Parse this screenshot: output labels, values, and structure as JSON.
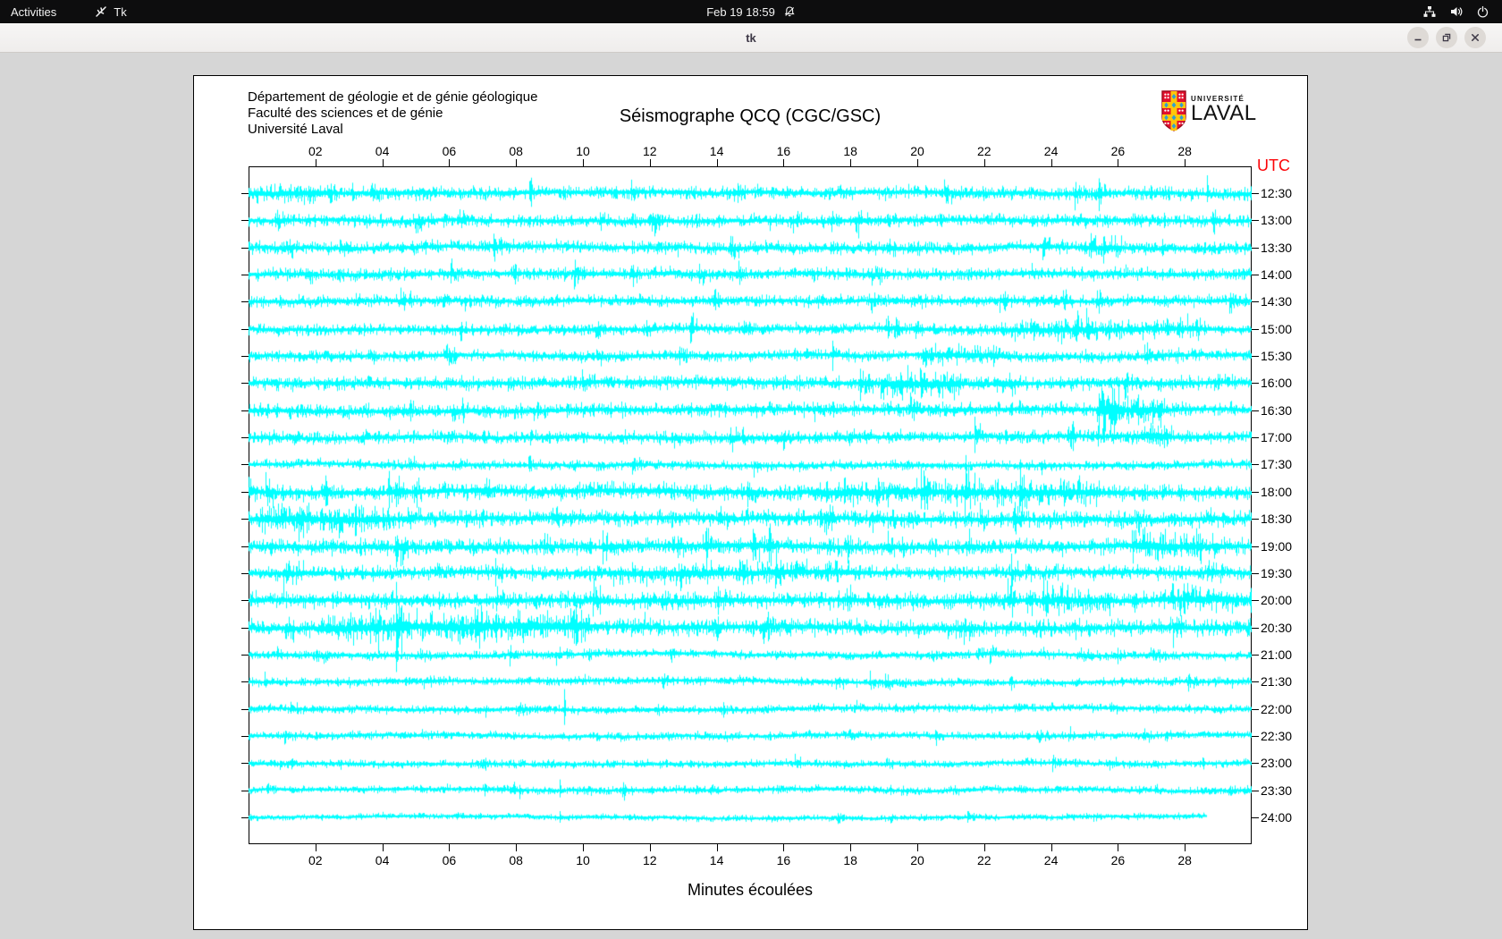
{
  "topbar": {
    "activities_label": "Activities",
    "app_label": "Tk",
    "clock": "Feb 19  18:59",
    "icons": [
      "tk-feather-icon",
      "notifications-disabled-icon",
      "network-wired-icon",
      "volume-icon",
      "power-icon"
    ]
  },
  "titlebar": {
    "title": "tk"
  },
  "header": {
    "line1": "Département de géologie et de génie géologique",
    "line2": "Faculté des sciences et de génie",
    "line3": "Université Laval"
  },
  "plot": {
    "title": "Séismographe QCQ (CGC/GSC)",
    "utc_label": "UTC",
    "xlabel": "Minutes écoulées",
    "x_range_minutes": [
      0,
      30
    ],
    "x_ticks": [
      "02",
      "04",
      "06",
      "08",
      "10",
      "12",
      "14",
      "16",
      "18",
      "20",
      "22",
      "24",
      "26",
      "28"
    ],
    "trace_color": "#00ffff",
    "utc_color": "#fb0408",
    "rows": [
      {
        "label": "12:30",
        "amp": 3.0,
        "end": 1,
        "bursts": [
          [
            0.0,
            0.08,
            1.5
          ]
        ],
        "spikes": [
          [
            0.955,
            20,
            10
          ]
        ]
      },
      {
        "label": "13:00",
        "amp": 2.8,
        "end": 1,
        "bursts": [],
        "spikes": [
          [
            0.4,
            7,
            5
          ],
          [
            0.52,
            5,
            12
          ]
        ]
      },
      {
        "label": "13:30",
        "amp": 2.8,
        "end": 1,
        "bursts": [
          [
            0.83,
            0.87,
            1.8
          ]
        ],
        "spikes": [
          [
            0.84,
            16,
            12
          ],
          [
            0.852,
            12,
            18
          ]
        ]
      },
      {
        "label": "14:00",
        "amp": 2.8,
        "end": 1,
        "bursts": [],
        "spikes": [
          [
            0.72,
            8,
            6
          ]
        ]
      },
      {
        "label": "14:30",
        "amp": 2.6,
        "end": 1,
        "bursts": [],
        "spikes": [
          [
            0.216,
            5,
            11
          ]
        ]
      },
      {
        "label": "15:00",
        "amp": 2.5,
        "end": 1,
        "bursts": [
          [
            0.75,
            0.95,
            1.9
          ]
        ],
        "spikes": [
          [
            0.953,
            9,
            7
          ]
        ]
      },
      {
        "label": "15:30",
        "amp": 2.5,
        "end": 1,
        "bursts": [
          [
            0.67,
            0.76,
            1.9
          ]
        ],
        "spikes": []
      },
      {
        "label": "16:00",
        "amp": 3.2,
        "end": 1,
        "bursts": [
          [
            0.63,
            0.71,
            2.3
          ]
        ],
        "spikes": []
      },
      {
        "label": "16:30",
        "amp": 3.2,
        "end": 1,
        "bursts": [
          [
            0.845,
            0.91,
            2.1
          ]
        ],
        "spikes": [
          [
            0.88,
            12,
            9
          ]
        ]
      },
      {
        "label": "17:00",
        "amp": 2.9,
        "end": 1,
        "bursts": [
          [
            0.88,
            0.92,
            1.8
          ]
        ],
        "spikes": [
          [
            0.234,
            8,
            6
          ],
          [
            0.281,
            6,
            9
          ]
        ]
      },
      {
        "label": "17:30",
        "amp": 2.1,
        "end": 1,
        "bursts": [],
        "spikes": []
      },
      {
        "label": "18:00",
        "amp": 3.9,
        "end": 1,
        "bursts": [
          [
            0.56,
            0.85,
            1.6
          ]
        ],
        "spikes": []
      },
      {
        "label": "18:30",
        "amp": 3.9,
        "end": 1,
        "bursts": [
          [
            0.01,
            0.14,
            1.7
          ]
        ],
        "spikes": []
      },
      {
        "label": "19:00",
        "amp": 3.8,
        "end": 1,
        "bursts": [
          [
            0.88,
            0.95,
            2.0
          ]
        ],
        "spikes": []
      },
      {
        "label": "19:30",
        "amp": 3.3,
        "end": 1,
        "bursts": [
          [
            0.36,
            0.61,
            1.5
          ]
        ],
        "spikes": []
      },
      {
        "label": "20:00",
        "amp": 3.8,
        "end": 1,
        "bursts": [
          [
            0.79,
            0.86,
            1.7
          ],
          [
            0.92,
            1.0,
            1.7
          ]
        ],
        "spikes": []
      },
      {
        "label": "20:30",
        "amp": 4.0,
        "end": 1,
        "bursts": [
          [
            0.07,
            0.34,
            1.9
          ]
        ],
        "spikes": [
          [
            0.324,
            20,
            8
          ]
        ]
      },
      {
        "label": "21:00",
        "amp": 1.9,
        "end": 1,
        "bursts": [],
        "spikes": [
          [
            0.317,
            7,
            5
          ]
        ]
      },
      {
        "label": "21:30",
        "amp": 1.8,
        "end": 1,
        "bursts": [],
        "spikes": []
      },
      {
        "label": "22:00",
        "amp": 1.8,
        "end": 1,
        "bursts": [],
        "spikes": [
          [
            0.315,
            22,
            18
          ]
        ]
      },
      {
        "label": "22:30",
        "amp": 1.8,
        "end": 1,
        "bursts": [],
        "spikes": [
          [
            0.79,
            7,
            5
          ]
        ]
      },
      {
        "label": "23:00",
        "amp": 1.7,
        "end": 1,
        "bursts": [],
        "spikes": []
      },
      {
        "label": "23:30",
        "amp": 1.6,
        "end": 1,
        "bursts": [],
        "spikes": [
          [
            0.27,
            6,
            10
          ],
          [
            0.31,
            12,
            8
          ]
        ]
      },
      {
        "label": "24:00",
        "amp": 1.3,
        "end": 0.955,
        "bursts": [],
        "spikes": [
          [
            0.31,
            7,
            6
          ]
        ]
      }
    ]
  },
  "logo": {
    "small": "UNIVERSITÉ",
    "large": "LAVAL",
    "shield_red": "#e30f2d",
    "shield_gold": "#ffc60a",
    "shield_blue": "#2e9fd4"
  }
}
